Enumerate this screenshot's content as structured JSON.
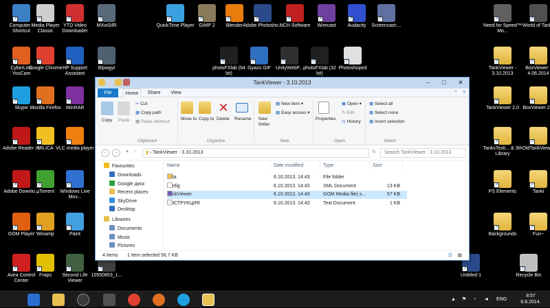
{
  "desktop_icons": [
    {
      "label": "Computer - Shortcut",
      "icon": "computer-icon",
      "color": "#3b7fc4"
    },
    {
      "label": "Media Player Classic",
      "icon": "media-player-icon",
      "color": "#cfcfcf"
    },
    {
      "label": "YTD Video Downloader",
      "icon": "ytd-icon",
      "color": "#d03030"
    },
    {
      "label": "MXwSifR",
      "icon": "image-icon",
      "color": "#5a6a7a"
    },
    {
      "label": "QuickTime Player",
      "icon": "quicktime-icon",
      "color": "#3aa0e0"
    },
    {
      "label": "GIMP 2",
      "icon": "gimp-icon",
      "color": "#8a7a5a"
    },
    {
      "label": "Blender",
      "icon": "blender-icon",
      "color": "#e87d0d"
    },
    {
      "label": "Adobe Photosho...",
      "icon": "photoshop-icon",
      "color": "#2a4a8a"
    },
    {
      "label": "NCH Software",
      "icon": "nch-icon",
      "color": "#c02020"
    },
    {
      "label": "Wirecast",
      "icon": "wirecast-icon",
      "color": "#7040a0"
    },
    {
      "label": "Audacity",
      "icon": "audacity-icon",
      "color": "#3050d0"
    },
    {
      "label": "Screencast-...",
      "icon": "screencast-icon",
      "color": "#6070a0"
    },
    {
      "label": "Need for Speed™ Mo...",
      "icon": "nfs-icon",
      "color": "#606060"
    },
    {
      "label": "World of Tanks",
      "icon": "wot-icon",
      "color": "#505050"
    },
    {
      "label": "CyberLink YouCam",
      "icon": "youcam-icon",
      "color": "#e06020"
    },
    {
      "label": "Google Chrome",
      "icon": "chrome-icon",
      "color": "#e04030"
    },
    {
      "label": "HP Support Assistant",
      "icon": "hp-support-icon",
      "color": "#2060c0"
    },
    {
      "label": "Blpwgyt",
      "icon": "image-icon",
      "color": "#506070"
    },
    {
      "label": "photoFXlab (64 bit)",
      "icon": "photofxlab-icon",
      "color": "#202020"
    },
    {
      "label": "Gyazo GIF",
      "icon": "gyazo-icon",
      "color": "#3070c0"
    },
    {
      "label": "UnityWebP...",
      "icon": "unity-icon",
      "color": "#303030"
    },
    {
      "label": "photoFXlab (32 bit)",
      "icon": "photofxlab-icon",
      "color": "#202020"
    },
    {
      "label": "Photoshoped",
      "icon": "document-icon",
      "color": "#e0e0e0"
    },
    {
      "label": "TankViewer - 3.10.2013",
      "icon": "folder-icon",
      "color": "#e8c050"
    },
    {
      "label": "BoxViewer - 4.06.2014",
      "icon": "folder-icon",
      "color": "#e8c050"
    },
    {
      "label": "Skype",
      "icon": "skype-icon",
      "color": "#1ea0e0"
    },
    {
      "label": "Mozilla Firefox",
      "icon": "firefox-icon",
      "color": "#e07020"
    },
    {
      "label": "WinRAR",
      "icon": "winrar-icon",
      "color": "#8030a0"
    },
    {
      "label": "TankViewer 2.0",
      "icon": "folder-icon",
      "color": "#e8c050"
    },
    {
      "label": "BoxViewer 2.0",
      "icon": "folder-icon",
      "color": "#e8c050"
    },
    {
      "label": "Adobe Reader XI",
      "icon": "adobe-reader-icon",
      "color": "#c01818"
    },
    {
      "label": "MILICA",
      "icon": "star-icon",
      "color": "#f0c020"
    },
    {
      "label": "VLC media player",
      "icon": "vlc-icon",
      "color": "#f08010"
    },
    {
      "label": "TanksTesti... & 3th Library",
      "icon": "folder-icon",
      "color": "#e8c050"
    },
    {
      "label": "OldTankViewer",
      "icon": "folder-icon",
      "color": "#e8c050"
    },
    {
      "label": "Adobe Downlo...",
      "icon": "adobe-download-icon",
      "color": "#c01818"
    },
    {
      "label": "µTorrent",
      "icon": "utorrent-icon",
      "color": "#40a030"
    },
    {
      "label": "Windows Live Mov...",
      "icon": "movie-maker-icon",
      "color": "#3070d0"
    },
    {
      "label": "PS Elements",
      "icon": "folder-icon",
      "color": "#e8c050"
    },
    {
      "label": "Tanki",
      "icon": "folder-icon",
      "color": "#e8c050"
    },
    {
      "label": "GOM Player",
      "icon": "gom-icon",
      "color": "#e06010"
    },
    {
      "label": "Winamp",
      "icon": "winamp-icon",
      "color": "#e0a020"
    },
    {
      "label": "Paint",
      "icon": "paint-icon",
      "color": "#40a0e0"
    },
    {
      "label": "Backgrounds",
      "icon": "folder-icon",
      "color": "#e8c050"
    },
    {
      "label": "Fun~",
      "icon": "folder-icon",
      "color": "#e8c050"
    },
    {
      "label": "Avira Control Center",
      "icon": "avira-icon",
      "color": "#d02020"
    },
    {
      "label": "Fraps",
      "icon": "fraps-icon",
      "color": "#e0c000"
    },
    {
      "label": "Second Life Viewer",
      "icon": "second-life-icon",
      "color": "#406040"
    },
    {
      "label": "10550853_1...",
      "icon": "image-icon",
      "color": "#404040"
    },
    {
      "label": "Untitled-1",
      "icon": "photoshop-file-icon",
      "color": "#2a4a8a"
    },
    {
      "label": "Recycle Bin",
      "icon": "recycle-bin-icon",
      "color": "#c0c0c0"
    }
  ],
  "window": {
    "title": "TankViewer - 3.10.2013",
    "tabs": [
      "File",
      "Home",
      "Share",
      "View"
    ],
    "ribbon": {
      "clipboard": {
        "copy": "Copy",
        "paste": "Paste",
        "cut": "Cut",
        "copy_path": "Copy path",
        "paste_shortcut": "Paste shortcut",
        "group": "Clipboard"
      },
      "organise": {
        "move_to": "Move to",
        "copy_to": "Copy to",
        "delete": "Delete",
        "rename": "Rename",
        "group": "Organise"
      },
      "new": {
        "new_folder": "New folder",
        "new_item": "New item",
        "easy_access": "Easy access",
        "group": "New"
      },
      "open": {
        "properties": "Properties",
        "open": "Open",
        "edit": "Edit",
        "history": "History",
        "group": "Open"
      },
      "select": {
        "select_all": "Select all",
        "select_none": "Select none",
        "invert": "Invert selection",
        "group": "Select"
      }
    },
    "address": "TankViewer - 3.10.2013",
    "search_placeholder": "Search TankViewer - 3.10.2013",
    "nav": {
      "favourites": "Favourites",
      "items": [
        "Downloads",
        "Google диск",
        "Recent places",
        "SkyDrive",
        "Desktop"
      ],
      "libraries": "Libraries",
      "lib_items": [
        "Documents",
        "Music",
        "Pictures"
      ]
    },
    "columns": {
      "name": "Name",
      "date": "Date modified",
      "type": "Type",
      "size": "Size"
    },
    "files": [
      {
        "name": "data",
        "date": "6.10.2013. 14:43",
        "type": "File folder",
        "size": "",
        "icon": "folder-icon"
      },
      {
        "name": "config",
        "date": "6.10.2013. 14:43",
        "type": "XML Document",
        "size": "13 KB",
        "icon": "xml-file-icon"
      },
      {
        "name": "TankViewer",
        "date": "6.10.2013. 14:43",
        "type": "GOM Media file(.s...",
        "size": "57 KB",
        "icon": "app-icon"
      },
      {
        "name": "ИНСТРУКЦИЯ",
        "date": "6.10.2013. 14:43",
        "type": "Text Document",
        "size": "1 KB",
        "icon": "text-file-icon"
      }
    ],
    "status": {
      "count": "4 items",
      "selected": "1 item selected  56,7 KB"
    }
  },
  "taskbar": {
    "lang": "ENG",
    "time": "8:57",
    "date": "6.8.2014."
  }
}
